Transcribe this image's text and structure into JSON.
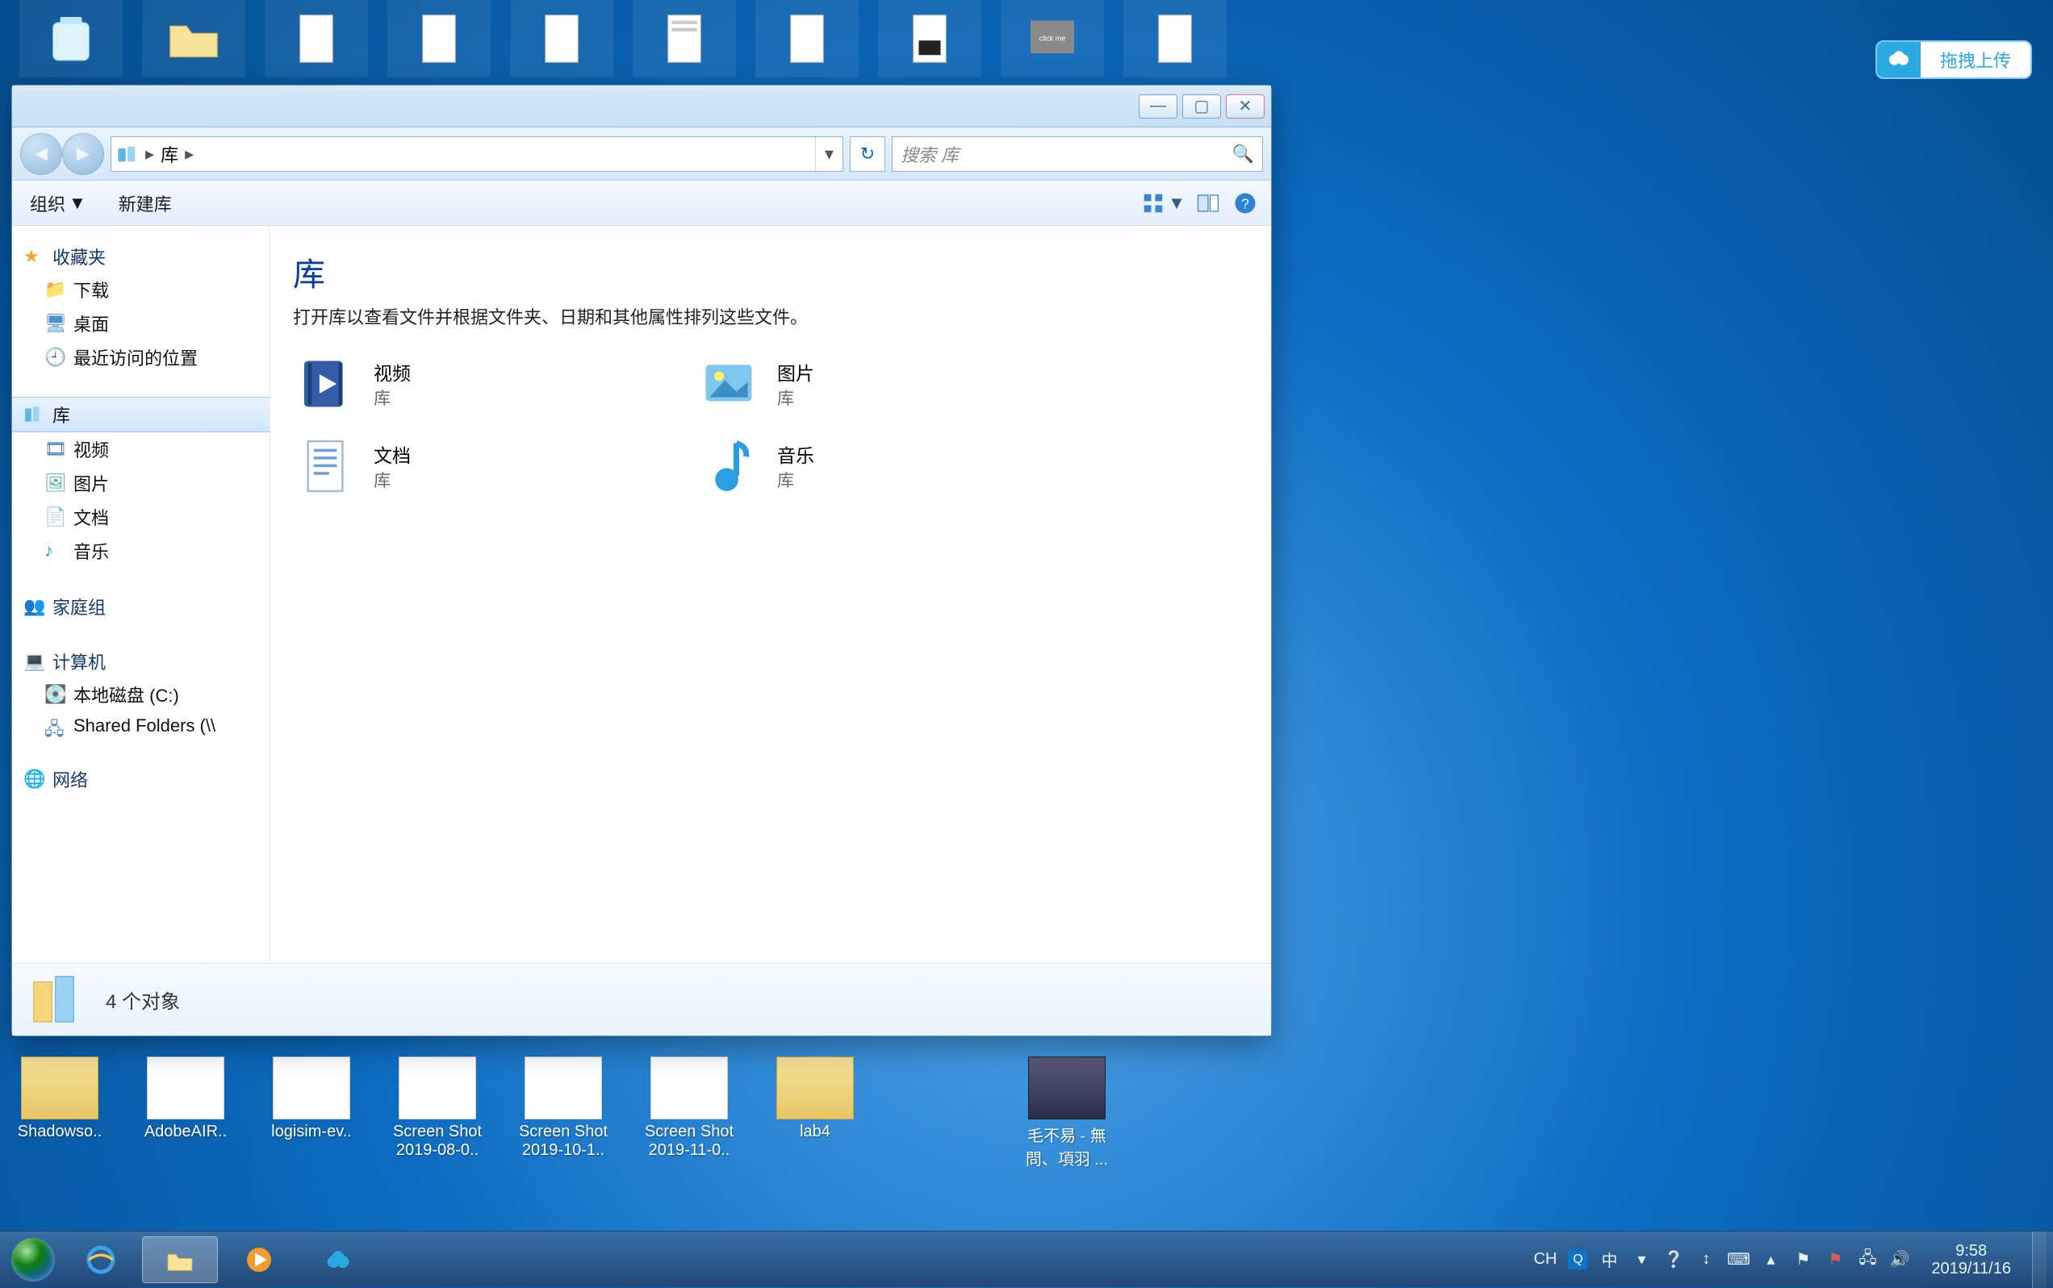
{
  "upload_badge": {
    "label": "拖拽上传"
  },
  "desktop_bottom": [
    {
      "label": "Shadowso..",
      "type": "folder"
    },
    {
      "label": "AdobeAIR..",
      "type": "file"
    },
    {
      "label": "logisim-ev..",
      "type": "file"
    },
    {
      "label": "Screen Shot",
      "label2": "2019-08-0..",
      "type": "file"
    },
    {
      "label": "Screen Shot",
      "label2": "2019-10-1..",
      "type": "file"
    },
    {
      "label": "Screen Shot",
      "label2": "2019-11-0..",
      "type": "file"
    },
    {
      "label": "lab4",
      "type": "folder"
    },
    {
      "label": "",
      "type": "spacer"
    },
    {
      "label": "毛不易 - 無",
      "label2": "問、項羽 ...",
      "type": "video"
    }
  ],
  "explorer": {
    "address": {
      "crumb1": "库",
      "dropdown": "▾"
    },
    "search": {
      "placeholder": "搜索 库"
    },
    "toolbar": {
      "organize": "组织",
      "newlib": "新建库"
    },
    "sidebar": {
      "favorites": {
        "label": "收藏夹",
        "items": [
          "下载",
          "桌面",
          "最近访问的位置"
        ]
      },
      "libraries": {
        "label": "库",
        "items": [
          "视频",
          "图片",
          "文档",
          "音乐"
        ]
      },
      "homegroup": {
        "label": "家庭组"
      },
      "computer": {
        "label": "计算机",
        "items": [
          "本地磁盘 (C:)",
          "Shared Folders (\\\\"
        ]
      },
      "network": {
        "label": "网络"
      }
    },
    "content": {
      "title": "库",
      "subtitle": "打开库以查看文件并根据文件夹、日期和其他属性排列这些文件。",
      "libs": [
        {
          "name": "视频",
          "kind": "库"
        },
        {
          "name": "图片",
          "kind": "库"
        },
        {
          "name": "文档",
          "kind": "库"
        },
        {
          "name": "音乐",
          "kind": "库"
        }
      ]
    },
    "status": {
      "text": "4 个对象"
    }
  },
  "tray": {
    "ch": "CH",
    "ime": "中",
    "time": "9:58",
    "date": "2019/11/16"
  }
}
